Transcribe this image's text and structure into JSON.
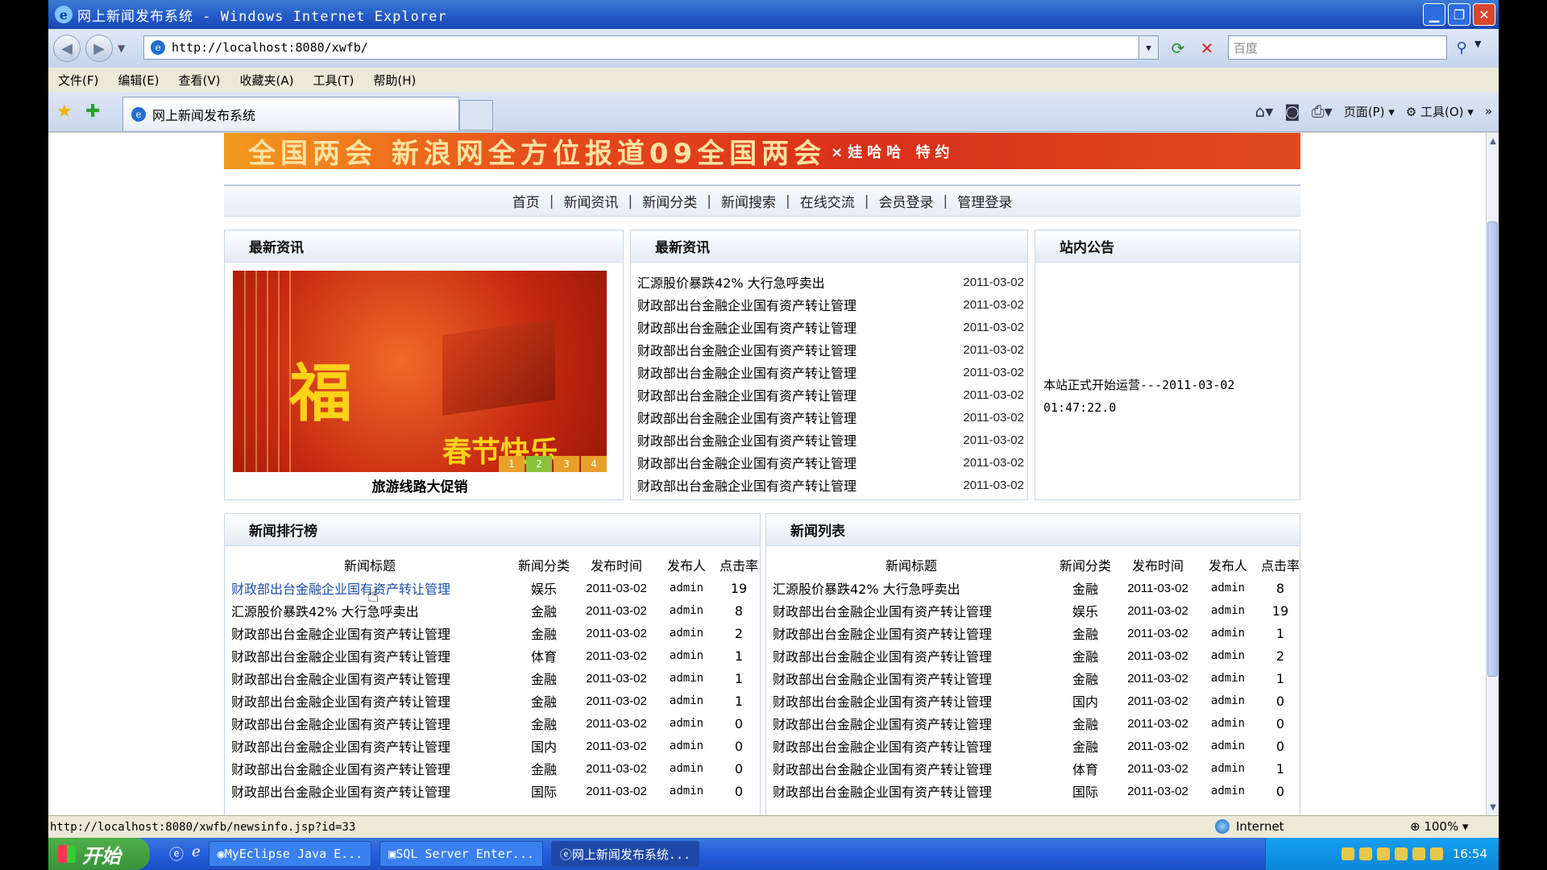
{
  "window": {
    "title": "网上新闻发布系统 - Windows Internet Explorer",
    "icon": "ie-icon"
  },
  "address": {
    "url": "http://localhost:8080/xwfb/",
    "search_placeholder": "百度"
  },
  "menu": [
    "文件(F)",
    "编辑(E)",
    "查看(V)",
    "收藏夹(A)",
    "工具(T)",
    "帮助(H)"
  ],
  "tab": {
    "title": "网上新闻发布系统"
  },
  "command_bar": {
    "page": "页面(P)",
    "tools": "工具(O)"
  },
  "page": {
    "banner_text": "全国两会 新浪网全方位报道09全国两会",
    "banner_sponsor": "×娃哈哈 特约",
    "nav": [
      "首页",
      "新闻资讯",
      "新闻分类",
      "新闻搜索",
      "在线交流",
      "会员登录",
      "管理登录"
    ],
    "latest_left": {
      "title": "最新资讯",
      "promo_fu": "福",
      "promo_text": "春节快乐",
      "promo_pages": [
        "1",
        "2",
        "3",
        "4"
      ],
      "caption": "旅游线路大促销"
    },
    "latest_right": {
      "title": "最新资讯",
      "items": [
        {
          "title": "汇源股价暴跌42% 大行急呼卖出",
          "date": "2011-03-02"
        },
        {
          "title": "财政部出台金融企业国有资产转让管理",
          "date": "2011-03-02"
        },
        {
          "title": "财政部出台金融企业国有资产转让管理",
          "date": "2011-03-02"
        },
        {
          "title": "财政部出台金融企业国有资产转让管理",
          "date": "2011-03-02"
        },
        {
          "title": "财政部出台金融企业国有资产转让管理",
          "date": "2011-03-02"
        },
        {
          "title": "财政部出台金融企业国有资产转让管理",
          "date": "2011-03-02"
        },
        {
          "title": "财政部出台金融企业国有资产转让管理",
          "date": "2011-03-02"
        },
        {
          "title": "财政部出台金融企业国有资产转让管理",
          "date": "2011-03-02"
        },
        {
          "title": "财政部出台金融企业国有资产转让管理",
          "date": "2011-03-02"
        },
        {
          "title": "财政部出台金融企业国有资产转让管理",
          "date": "2011-03-02"
        }
      ]
    },
    "notice": {
      "title": "站内公告",
      "line1": "本站正式开始运营---2011-03-02",
      "line2": "01:47:22.0"
    },
    "ranking": {
      "title": "新闻排行榜",
      "columns": [
        "新闻标题",
        "新闻分类",
        "发布时间",
        "发布人",
        "点击率"
      ],
      "rows": [
        [
          "财政部出台金融企业国有资产转让管理",
          "娱乐",
          "2011-03-02",
          "admin",
          "19"
        ],
        [
          "汇源股价暴跌42% 大行急呼卖出",
          "金融",
          "2011-03-02",
          "admin",
          "8"
        ],
        [
          "财政部出台金融企业国有资产转让管理",
          "金融",
          "2011-03-02",
          "admin",
          "2"
        ],
        [
          "财政部出台金融企业国有资产转让管理",
          "体育",
          "2011-03-02",
          "admin",
          "1"
        ],
        [
          "财政部出台金融企业国有资产转让管理",
          "金融",
          "2011-03-02",
          "admin",
          "1"
        ],
        [
          "财政部出台金融企业国有资产转让管理",
          "金融",
          "2011-03-02",
          "admin",
          "1"
        ],
        [
          "财政部出台金融企业国有资产转让管理",
          "金融",
          "2011-03-02",
          "admin",
          "0"
        ],
        [
          "财政部出台金融企业国有资产转让管理",
          "国内",
          "2011-03-02",
          "admin",
          "0"
        ],
        [
          "财政部出台金融企业国有资产转让管理",
          "金融",
          "2011-03-02",
          "admin",
          "0"
        ],
        [
          "财政部出台金融企业国有资产转让管理",
          "国际",
          "2011-03-02",
          "admin",
          "0"
        ]
      ]
    },
    "list": {
      "title": "新闻列表",
      "columns": [
        "新闻标题",
        "新闻分类",
        "发布时间",
        "发布人",
        "点击率"
      ],
      "rows": [
        [
          "汇源股价暴跌42% 大行急呼卖出",
          "金融",
          "2011-03-02",
          "admin",
          "8"
        ],
        [
          "财政部出台金融企业国有资产转让管理",
          "娱乐",
          "2011-03-02",
          "admin",
          "19"
        ],
        [
          "财政部出台金融企业国有资产转让管理",
          "金融",
          "2011-03-02",
          "admin",
          "1"
        ],
        [
          "财政部出台金融企业国有资产转让管理",
          "金融",
          "2011-03-02",
          "admin",
          "2"
        ],
        [
          "财政部出台金融企业国有资产转让管理",
          "金融",
          "2011-03-02",
          "admin",
          "1"
        ],
        [
          "财政部出台金融企业国有资产转让管理",
          "国内",
          "2011-03-02",
          "admin",
          "0"
        ],
        [
          "财政部出台金融企业国有资产转让管理",
          "金融",
          "2011-03-02",
          "admin",
          "0"
        ],
        [
          "财政部出台金融企业国有资产转让管理",
          "金融",
          "2011-03-02",
          "admin",
          "0"
        ],
        [
          "财政部出台金融企业国有资产转让管理",
          "体育",
          "2011-03-02",
          "admin",
          "1"
        ],
        [
          "财政部出台金融企业国有资产转让管理",
          "国际",
          "2011-03-02",
          "admin",
          "0"
        ]
      ]
    }
  },
  "status": {
    "url": "http://localhost:8080/xwfb/newsinfo.jsp?id=33",
    "zone": "Internet",
    "zoom": "100%"
  },
  "taskbar": {
    "start": "开始",
    "items": [
      "MyEclipse Java E...",
      "SQL Server Enter...",
      "网上新闻发布系统..."
    ],
    "active_index": 2,
    "clock": "16:54"
  }
}
